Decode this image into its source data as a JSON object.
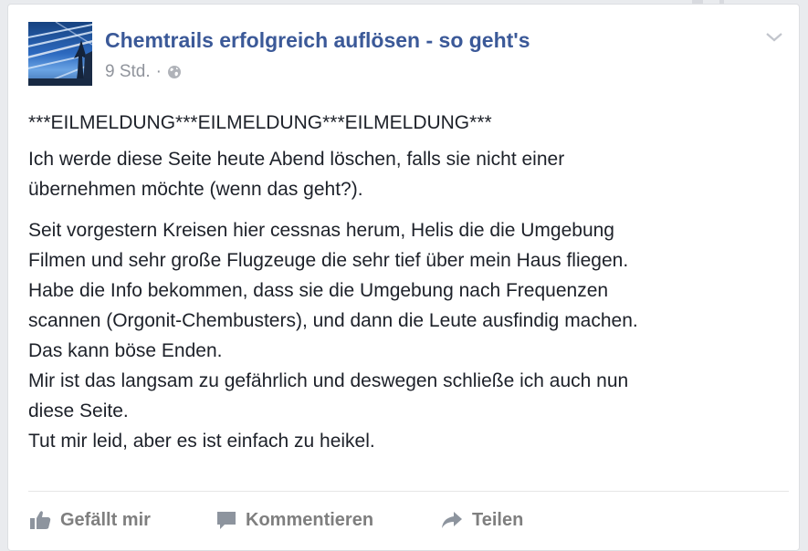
{
  "post": {
    "page_name": "Chemtrails erfolgreich auflösen - so geht's",
    "time": "9 Std.",
    "separator": "·",
    "privacy_icon": "globe-icon",
    "menu_icon": "chevron-down-icon",
    "paragraphs": [
      [
        "***EILMELDUNG***EILMELDUNG***EILMELDUNG***"
      ],
      [
        "Ich werde diese Seite heute Abend löschen, falls sie nicht einer",
        "übernehmen möchte (wenn das geht?)."
      ],
      [
        "Seit vorgestern Kreisen hier cessnas herum, Helis die die Umgebung",
        "Filmen und sehr große Flugzeuge die sehr tief über mein Haus fliegen.",
        "Habe die Info bekommen, dass sie die Umgebung nach Frequenzen",
        "scannen (Orgonit-Chembusters), und dann die Leute ausfindig machen.",
        "Das kann böse Enden.",
        "Mir ist das langsam zu gefährlich und deswegen schließe ich auch nun",
        "diese Seite.",
        "Tut mir leid, aber es ist einfach zu heikel."
      ]
    ]
  },
  "actions": {
    "like_label": "Gefällt mir",
    "like_icon": "thumbs-up-icon",
    "comment_label": "Kommentieren",
    "comment_icon": "speech-bubble-icon",
    "share_label": "Teilen",
    "share_icon": "share-arrow-icon"
  },
  "colors": {
    "link": "#3b5998",
    "meta": "#90949c",
    "text": "#1d2129",
    "action": "#7f7f7f"
  }
}
